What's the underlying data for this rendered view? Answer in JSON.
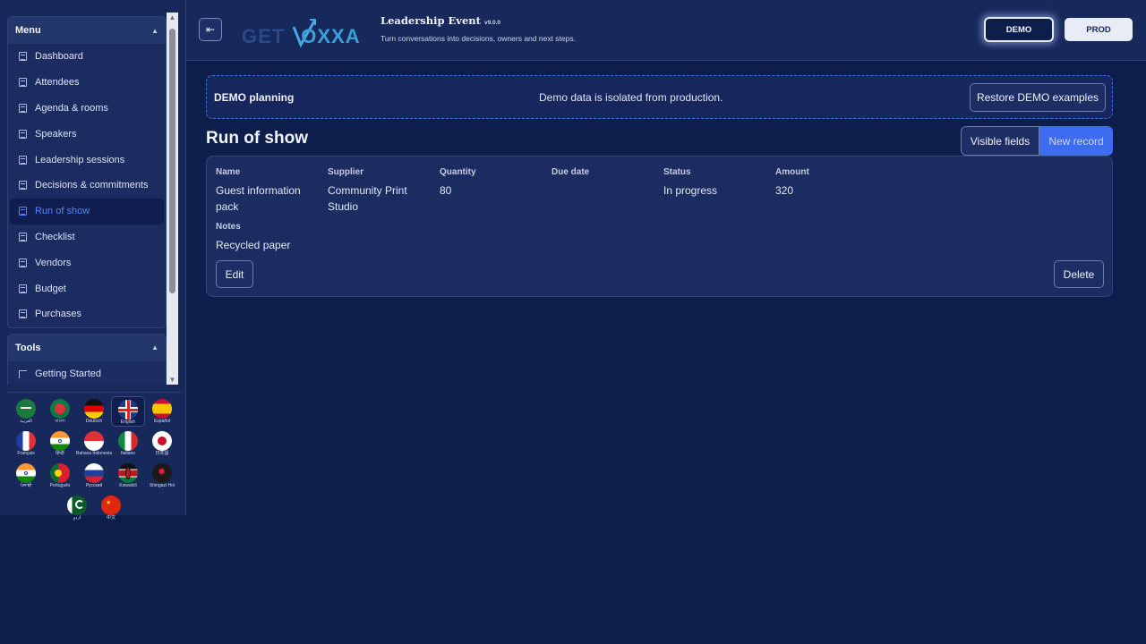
{
  "sidebar": {
    "menu": {
      "title": "Menu",
      "items": [
        {
          "label": "Dashboard"
        },
        {
          "label": "Attendees"
        },
        {
          "label": "Agenda & rooms"
        },
        {
          "label": "Speakers"
        },
        {
          "label": "Leadership sessions"
        },
        {
          "label": "Decisions & commitments"
        },
        {
          "label": "Run of show",
          "active": true
        },
        {
          "label": "Checklist"
        },
        {
          "label": "Vendors"
        },
        {
          "label": "Budget"
        },
        {
          "label": "Purchases"
        }
      ]
    },
    "tools": {
      "title": "Tools",
      "items": [
        {
          "label": "Getting Started"
        }
      ]
    },
    "languages": [
      {
        "label": "العربية",
        "flag": "saudi-arabia"
      },
      {
        "label": "বাংলা",
        "flag": "bangladesh"
      },
      {
        "label": "Deutsch",
        "flag": "germany"
      },
      {
        "label": "English",
        "flag": "united-kingdom",
        "selected": true
      },
      {
        "label": "Español",
        "flag": "spain"
      },
      {
        "label": "Français",
        "flag": "france"
      },
      {
        "label": "हिन्दी",
        "flag": "india"
      },
      {
        "label": "Bahasa Indonesia",
        "flag": "indonesia"
      },
      {
        "label": "Italiano",
        "flag": "italy"
      },
      {
        "label": "日本語",
        "flag": "japan"
      },
      {
        "label": "ਪੰਜਾਬੀ",
        "flag": "india"
      },
      {
        "label": "Português",
        "flag": "portugal"
      },
      {
        "label": "Русский",
        "flag": "russia"
      },
      {
        "label": "Kiswahili",
        "flag": "kenya"
      },
      {
        "label": "Shingazi Hoi",
        "flag": "other"
      },
      {
        "label": "اردو",
        "flag": "pakistan"
      },
      {
        "label": "中文",
        "flag": "china"
      }
    ]
  },
  "header": {
    "collapse_icon": "collapse-sidebar-icon",
    "logo_text_a": "GET",
    "logo_text_b": "OXXA",
    "title": "Leadership Event",
    "version": "v9.0.0",
    "tagline": "Turn conversations into decisions, owners and next steps.",
    "demo_label": "DEMO",
    "prod_label": "PROD"
  },
  "banner": {
    "title": "DEMO planning",
    "message": "Demo data is isolated from production.",
    "restore_label": "Restore DEMO examples"
  },
  "page": {
    "title": "Run of show",
    "visible_fields_label": "Visible fields",
    "new_record_label": "New record"
  },
  "record": {
    "fields": {
      "name": {
        "label": "Name",
        "value": "Guest information pack"
      },
      "supplier": {
        "label": "Supplier",
        "value": "Community Print Studio"
      },
      "quantity": {
        "label": "Quantity",
        "value": "80"
      },
      "due_date": {
        "label": "Due date",
        "value": ""
      },
      "status": {
        "label": "Status",
        "value": "In progress"
      },
      "amount": {
        "label": "Amount",
        "value": "320"
      },
      "notes": {
        "label": "Notes",
        "value": "Recycled paper"
      }
    },
    "edit_label": "Edit",
    "delete_label": "Delete"
  },
  "colors": {
    "background": "#0d1d4c",
    "panel": "#1a2c60",
    "accent": "#3d6cf0",
    "active_nav": "#4f86ff"
  }
}
